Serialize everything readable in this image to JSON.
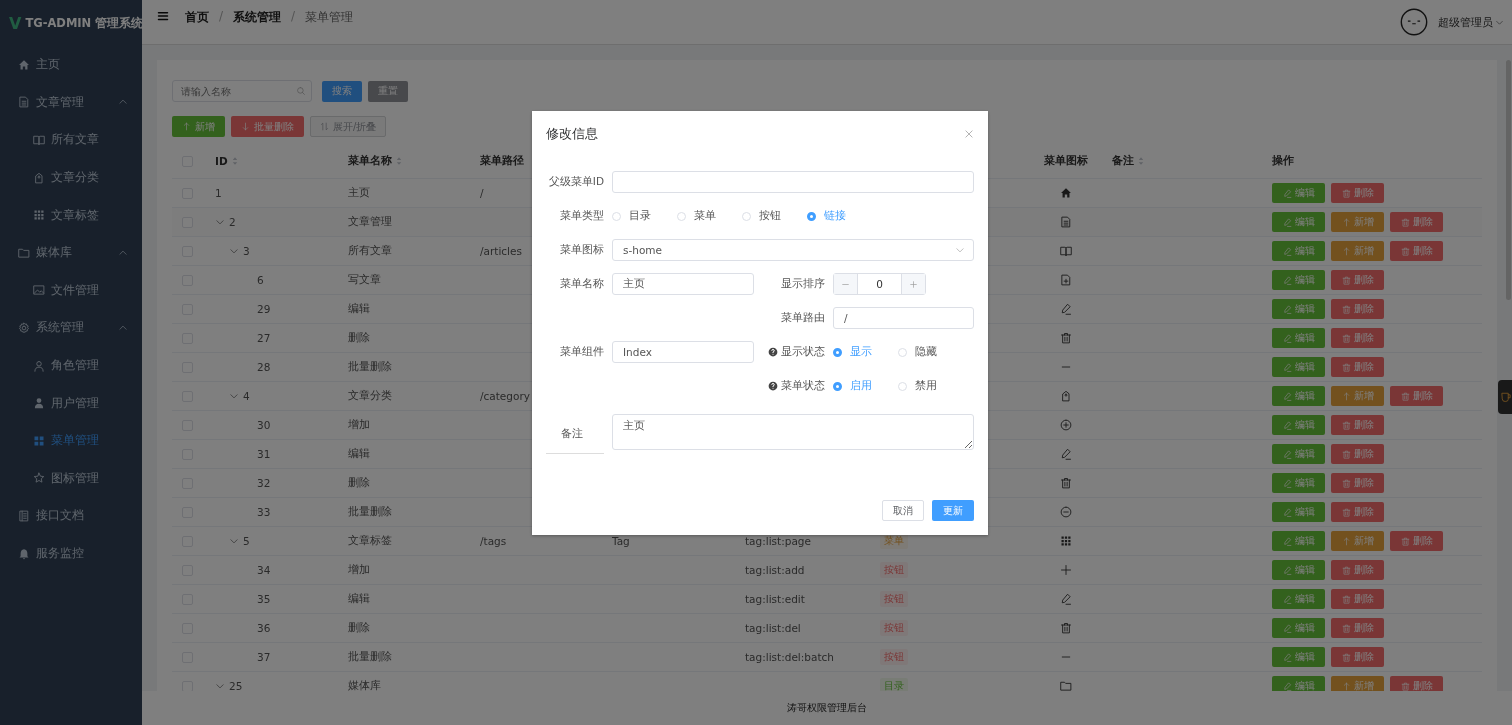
{
  "sidebar": {
    "logo_mark": "V",
    "logo_text": "TG-ADMIN 管理系统",
    "items": [
      {
        "label": "主页",
        "selected": false
      },
      {
        "label": "文章管理",
        "selected": false,
        "expanded": true,
        "children": [
          {
            "label": "所有文章",
            "selected": false
          },
          {
            "label": "文章分类",
            "selected": false
          },
          {
            "label": "文章标签",
            "selected": false
          }
        ]
      },
      {
        "label": "媒体库",
        "selected": false,
        "expanded": true,
        "children": [
          {
            "label": "文件管理",
            "selected": false
          }
        ]
      },
      {
        "label": "系统管理",
        "selected": false,
        "expanded": true,
        "children": [
          {
            "label": "角色管理",
            "selected": false
          },
          {
            "label": "用户管理",
            "selected": false
          },
          {
            "label": "菜单管理",
            "selected": true
          },
          {
            "label": "图标管理",
            "selected": false
          }
        ]
      },
      {
        "label": "接口文档",
        "selected": false
      },
      {
        "label": "服务监控",
        "selected": false
      }
    ]
  },
  "header": {
    "breadcrumb": {
      "separator": "/",
      "items": [
        "首页",
        "系统管理",
        "菜单管理"
      ]
    },
    "user": "超级管理员"
  },
  "search": {
    "placeholder": "请输入名称",
    "buttons": [
      {
        "label": "搜索",
        "kind": "primary"
      },
      {
        "label": "重置",
        "kind": "dark"
      }
    ]
  },
  "toolbar": [
    {
      "label": "新增",
      "kind": "success"
    },
    {
      "label": "批量删除",
      "kind": "danger"
    },
    {
      "label": "展开/折叠",
      "kind": "plain"
    }
  ],
  "table": {
    "select_all_checked": false,
    "columns": [
      "ID",
      "菜单名称",
      "菜单路径",
      "菜单图标",
      "备注",
      "操作"
    ],
    "rows": [
      {
        "id": "1",
        "name": "主页",
        "path": "/",
        "checked": false,
        "actions": [
          {
            "kind": "edit",
            "label": "编辑"
          },
          {
            "kind": "delete",
            "label": "删除"
          }
        ]
      },
      {
        "id": "2",
        "name": "文章管理",
        "checked": false,
        "expanded": true,
        "actions": [
          {
            "kind": "edit",
            "label": "编辑"
          },
          {
            "kind": "add",
            "label": "新增"
          },
          {
            "kind": "delete",
            "label": "删除"
          }
        ],
        "children": [
          {
            "id": "3",
            "name": "所有文章",
            "path": "/articles",
            "checked": false,
            "expanded": true,
            "actions": [
              {
                "kind": "edit",
                "label": "编辑"
              },
              {
                "kind": "add",
                "label": "新增"
              },
              {
                "kind": "delete",
                "label": "删除"
              }
            ],
            "children": [
              {
                "id": "6",
                "name": "写文章",
                "checked": false,
                "actions": [
                  {
                    "kind": "edit",
                    "label": "编辑"
                  },
                  {
                    "kind": "delete",
                    "label": "删除"
                  }
                ]
              },
              {
                "id": "29",
                "name": "编辑",
                "checked": false,
                "actions": [
                  {
                    "kind": "edit",
                    "label": "编辑"
                  },
                  {
                    "kind": "delete",
                    "label": "删除"
                  }
                ]
              },
              {
                "id": "27",
                "name": "删除",
                "checked": false,
                "actions": [
                  {
                    "kind": "edit",
                    "label": "编辑"
                  },
                  {
                    "kind": "delete",
                    "label": "删除"
                  }
                ]
              },
              {
                "id": "28",
                "name": "批量删除",
                "checked": false,
                "actions": [
                  {
                    "kind": "edit",
                    "label": "编辑"
                  },
                  {
                    "kind": "delete",
                    "label": "删除"
                  }
                ]
              }
            ]
          },
          {
            "id": "4",
            "name": "文章分类",
            "path": "/category",
            "checked": false,
            "expanded": true,
            "actions": [
              {
                "kind": "edit",
                "label": "编辑"
              },
              {
                "kind": "add",
                "label": "新增"
              },
              {
                "kind": "delete",
                "label": "删除"
              }
            ],
            "children": [
              {
                "id": "30",
                "name": "增加",
                "checked": false,
                "actions": [
                  {
                    "kind": "edit",
                    "label": "编辑"
                  },
                  {
                    "kind": "delete",
                    "label": "删除"
                  }
                ]
              },
              {
                "id": "31",
                "name": "编辑",
                "checked": false,
                "actions": [
                  {
                    "kind": "edit",
                    "label": "编辑"
                  },
                  {
                    "kind": "delete",
                    "label": "删除"
                  }
                ]
              },
              {
                "id": "32",
                "name": "删除",
                "checked": false,
                "actions": [
                  {
                    "kind": "edit",
                    "label": "编辑"
                  },
                  {
                    "kind": "delete",
                    "label": "删除"
                  }
                ]
              },
              {
                "id": "33",
                "name": "批量删除",
                "checked": false,
                "actions": [
                  {
                    "kind": "edit",
                    "label": "编辑"
                  },
                  {
                    "kind": "delete",
                    "label": "删除"
                  }
                ]
              }
            ]
          },
          {
            "id": "5",
            "name": "文章标签",
            "path": "/tags",
            "component": "Tag",
            "perms": "tag:list:page",
            "type": {
              "label": "菜单",
              "kind": "menu"
            },
            "checked": false,
            "expanded": true,
            "actions": [
              {
                "kind": "edit",
                "label": "编辑"
              },
              {
                "kind": "add",
                "label": "新增"
              },
              {
                "kind": "delete",
                "label": "删除"
              }
            ],
            "children": [
              {
                "id": "34",
                "name": "增加",
                "perms": "tag:list:add",
                "type": {
                  "label": "按钮",
                  "kind": "button"
                },
                "checked": false,
                "actions": [
                  {
                    "kind": "edit",
                    "label": "编辑"
                  },
                  {
                    "kind": "delete",
                    "label": "删除"
                  }
                ]
              },
              {
                "id": "35",
                "name": "编辑",
                "perms": "tag:list:edit",
                "type": {
                  "label": "按钮",
                  "kind": "button"
                },
                "checked": false,
                "actions": [
                  {
                    "kind": "edit",
                    "label": "编辑"
                  },
                  {
                    "kind": "delete",
                    "label": "删除"
                  }
                ]
              },
              {
                "id": "36",
                "name": "删除",
                "perms": "tag:list:del",
                "type": {
                  "label": "按钮",
                  "kind": "button"
                },
                "checked": false,
                "actions": [
                  {
                    "kind": "edit",
                    "label": "编辑"
                  },
                  {
                    "kind": "delete",
                    "label": "删除"
                  }
                ]
              },
              {
                "id": "37",
                "name": "批量删除",
                "perms": "tag:list:del:batch",
                "type": {
                  "label": "按钮",
                  "kind": "button"
                },
                "checked": false,
                "actions": [
                  {
                    "kind": "edit",
                    "label": "编辑"
                  },
                  {
                    "kind": "delete",
                    "label": "删除"
                  }
                ]
              }
            ]
          }
        ]
      },
      {
        "id": "25",
        "name": "媒体库",
        "type": {
          "label": "目录",
          "kind": "directory"
        },
        "checked": false,
        "expanded": true,
        "actions": [
          {
            "kind": "edit",
            "label": "编辑"
          },
          {
            "kind": "add",
            "label": "新增"
          },
          {
            "kind": "delete",
            "label": "删除"
          }
        ]
      }
    ]
  },
  "footer": "涛哥权限管理后台",
  "dialog": {
    "title": "修改信息",
    "parent_id": {
      "label": "父级菜单ID"
    },
    "menu_type": {
      "label": "菜单类型",
      "options": [
        {
          "label": "目录",
          "selected": false
        },
        {
          "label": "菜单",
          "selected": false
        },
        {
          "label": "按钮",
          "selected": false
        },
        {
          "label": "链接",
          "selected": true
        }
      ]
    },
    "menu_icon": {
      "label": "菜单图标",
      "value": "s-home"
    },
    "menu_name": {
      "label": "菜单名称",
      "value": "主页"
    },
    "sort": {
      "label": "显示排序",
      "value": "0"
    },
    "route": {
      "label": "菜单路由",
      "value": "/"
    },
    "component": {
      "label": "菜单组件",
      "value": "Index"
    },
    "visible": {
      "label": "显示状态",
      "options": [
        {
          "label": "显示",
          "selected": true
        },
        {
          "label": "隐藏",
          "selected": false
        }
      ]
    },
    "status": {
      "label": "菜单状态",
      "options": [
        {
          "label": "启用",
          "selected": true
        },
        {
          "label": "禁用",
          "selected": false
        }
      ]
    },
    "remark": {
      "label": "备注",
      "value": "主页"
    },
    "buttons": [
      {
        "label": "取消",
        "kind": "default"
      },
      {
        "label": "更新",
        "kind": "primary"
      }
    ]
  }
}
